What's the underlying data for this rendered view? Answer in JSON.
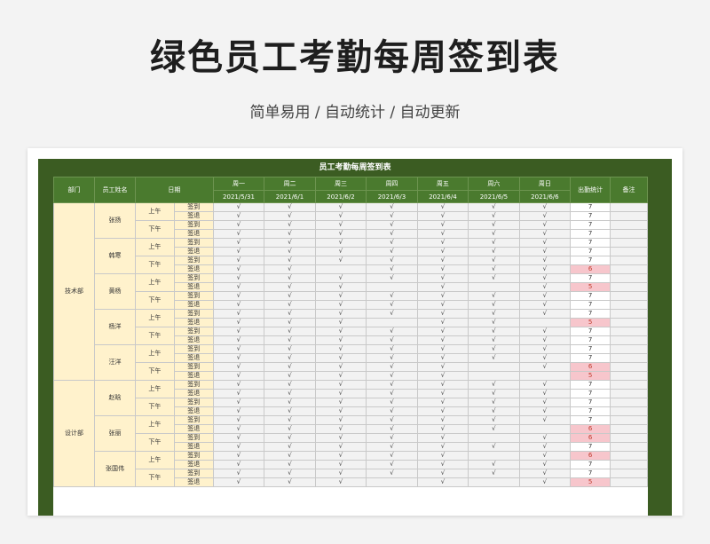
{
  "header": {
    "title": "绿色员工考勤每周签到表",
    "subtitle": "简单易用 / 自动统计 / 自动更新"
  },
  "sheet": {
    "title": "员工考勤每周签到表",
    "columns": {
      "dept": "部门",
      "name": "员工姓名",
      "date": "日期",
      "total": "出勤统计",
      "note": "备注"
    },
    "days": [
      {
        "label": "周一",
        "date": "2021/5/31"
      },
      {
        "label": "周二",
        "date": "2021/6/1"
      },
      {
        "label": "周三",
        "date": "2021/6/2"
      },
      {
        "label": "周四",
        "date": "2021/6/3"
      },
      {
        "label": "周五",
        "date": "2021/6/4"
      },
      {
        "label": "周六",
        "date": "2021/6/5"
      },
      {
        "label": "周日",
        "date": "2021/6/6"
      }
    ],
    "check_mark": "√",
    "departments": [
      {
        "name": "技术部",
        "employees": [
          {
            "name": "张扬",
            "rows": [
              {
                "period": "上午",
                "kind": "签到",
                "marks": [
                  1,
                  1,
                  1,
                  1,
                  1,
                  1,
                  1
                ],
                "total": "7"
              },
              {
                "period": "上午",
                "kind": "签退",
                "marks": [
                  1,
                  1,
                  1,
                  1,
                  1,
                  1,
                  1
                ],
                "total": "7"
              },
              {
                "period": "下午",
                "kind": "签到",
                "marks": [
                  1,
                  1,
                  1,
                  1,
                  1,
                  1,
                  1
                ],
                "total": "7"
              },
              {
                "period": "下午",
                "kind": "签退",
                "marks": [
                  1,
                  1,
                  1,
                  1,
                  1,
                  1,
                  1
                ],
                "total": "7"
              }
            ]
          },
          {
            "name": "韩寒",
            "rows": [
              {
                "period": "上午",
                "kind": "签到",
                "marks": [
                  1,
                  1,
                  1,
                  1,
                  1,
                  1,
                  1
                ],
                "total": "7"
              },
              {
                "period": "上午",
                "kind": "签退",
                "marks": [
                  1,
                  1,
                  1,
                  1,
                  1,
                  1,
                  1
                ],
                "total": "7"
              },
              {
                "period": "下午",
                "kind": "签到",
                "marks": [
                  1,
                  1,
                  1,
                  1,
                  1,
                  1,
                  1
                ],
                "total": "7"
              },
              {
                "period": "下午",
                "kind": "签退",
                "marks": [
                  1,
                  1,
                  0,
                  1,
                  1,
                  1,
                  1
                ],
                "total": "6"
              }
            ]
          },
          {
            "name": "黄杨",
            "rows": [
              {
                "period": "上午",
                "kind": "签到",
                "marks": [
                  1,
                  1,
                  1,
                  1,
                  1,
                  1,
                  1
                ],
                "total": "7"
              },
              {
                "period": "上午",
                "kind": "签退",
                "marks": [
                  1,
                  1,
                  1,
                  0,
                  1,
                  0,
                  1
                ],
                "total": "5"
              },
              {
                "period": "下午",
                "kind": "签到",
                "marks": [
                  1,
                  1,
                  1,
                  1,
                  1,
                  1,
                  1
                ],
                "total": "7"
              },
              {
                "period": "下午",
                "kind": "签退",
                "marks": [
                  1,
                  1,
                  1,
                  1,
                  1,
                  1,
                  1
                ],
                "total": "7"
              }
            ]
          },
          {
            "name": "杨洋",
            "rows": [
              {
                "period": "上午",
                "kind": "签到",
                "marks": [
                  1,
                  1,
                  1,
                  1,
                  1,
                  1,
                  1
                ],
                "total": "7"
              },
              {
                "period": "上午",
                "kind": "签退",
                "marks": [
                  1,
                  1,
                  1,
                  0,
                  1,
                  1,
                  0
                ],
                "total": "5"
              },
              {
                "period": "下午",
                "kind": "签到",
                "marks": [
                  1,
                  1,
                  1,
                  1,
                  1,
                  1,
                  1
                ],
                "total": "7"
              },
              {
                "period": "下午",
                "kind": "签退",
                "marks": [
                  1,
                  1,
                  1,
                  1,
                  1,
                  1,
                  1
                ],
                "total": "7"
              }
            ]
          },
          {
            "name": "汪洋",
            "rows": [
              {
                "period": "上午",
                "kind": "签到",
                "marks": [
                  1,
                  1,
                  1,
                  1,
                  1,
                  1,
                  1
                ],
                "total": "7"
              },
              {
                "period": "上午",
                "kind": "签退",
                "marks": [
                  1,
                  1,
                  1,
                  1,
                  1,
                  1,
                  1
                ],
                "total": "7"
              },
              {
                "period": "下午",
                "kind": "签到",
                "marks": [
                  1,
                  1,
                  1,
                  1,
                  1,
                  0,
                  1
                ],
                "total": "6"
              },
              {
                "period": "下午",
                "kind": "签退",
                "marks": [
                  1,
                  1,
                  1,
                  1,
                  1,
                  0,
                  0
                ],
                "total": "5"
              }
            ]
          }
        ]
      },
      {
        "name": "设计部",
        "employees": [
          {
            "name": "赵晗",
            "rows": [
              {
                "period": "上午",
                "kind": "签到",
                "marks": [
                  1,
                  1,
                  1,
                  1,
                  1,
                  1,
                  1
                ],
                "total": "7"
              },
              {
                "period": "上午",
                "kind": "签退",
                "marks": [
                  1,
                  1,
                  1,
                  1,
                  1,
                  1,
                  1
                ],
                "total": "7"
              },
              {
                "period": "下午",
                "kind": "签到",
                "marks": [
                  1,
                  1,
                  1,
                  1,
                  1,
                  1,
                  1
                ],
                "total": "7"
              },
              {
                "period": "下午",
                "kind": "签退",
                "marks": [
                  1,
                  1,
                  1,
                  1,
                  1,
                  1,
                  1
                ],
                "total": "7"
              }
            ]
          },
          {
            "name": "张丽",
            "rows": [
              {
                "period": "上午",
                "kind": "签到",
                "marks": [
                  1,
                  1,
                  1,
                  1,
                  1,
                  1,
                  1
                ],
                "total": "7"
              },
              {
                "period": "上午",
                "kind": "签退",
                "marks": [
                  1,
                  1,
                  1,
                  1,
                  1,
                  1,
                  0
                ],
                "total": "6"
              },
              {
                "period": "下午",
                "kind": "签到",
                "marks": [
                  1,
                  1,
                  1,
                  1,
                  1,
                  0,
                  1
                ],
                "total": "6"
              },
              {
                "period": "下午",
                "kind": "签退",
                "marks": [
                  1,
                  1,
                  1,
                  1,
                  1,
                  1,
                  1
                ],
                "total": "7"
              }
            ]
          },
          {
            "name": "张国伟",
            "rows": [
              {
                "period": "上午",
                "kind": "签到",
                "marks": [
                  1,
                  1,
                  1,
                  1,
                  1,
                  0,
                  1
                ],
                "total": "6"
              },
              {
                "period": "上午",
                "kind": "签退",
                "marks": [
                  1,
                  1,
                  1,
                  1,
                  1,
                  1,
                  1
                ],
                "total": "7"
              },
              {
                "period": "下午",
                "kind": "签到",
                "marks": [
                  1,
                  1,
                  1,
                  1,
                  1,
                  1,
                  1
                ],
                "total": "7"
              },
              {
                "period": "下午",
                "kind": "签退",
                "marks": [
                  1,
                  1,
                  1,
                  0,
                  1,
                  0,
                  1
                ],
                "total": "5"
              }
            ]
          }
        ]
      }
    ]
  }
}
